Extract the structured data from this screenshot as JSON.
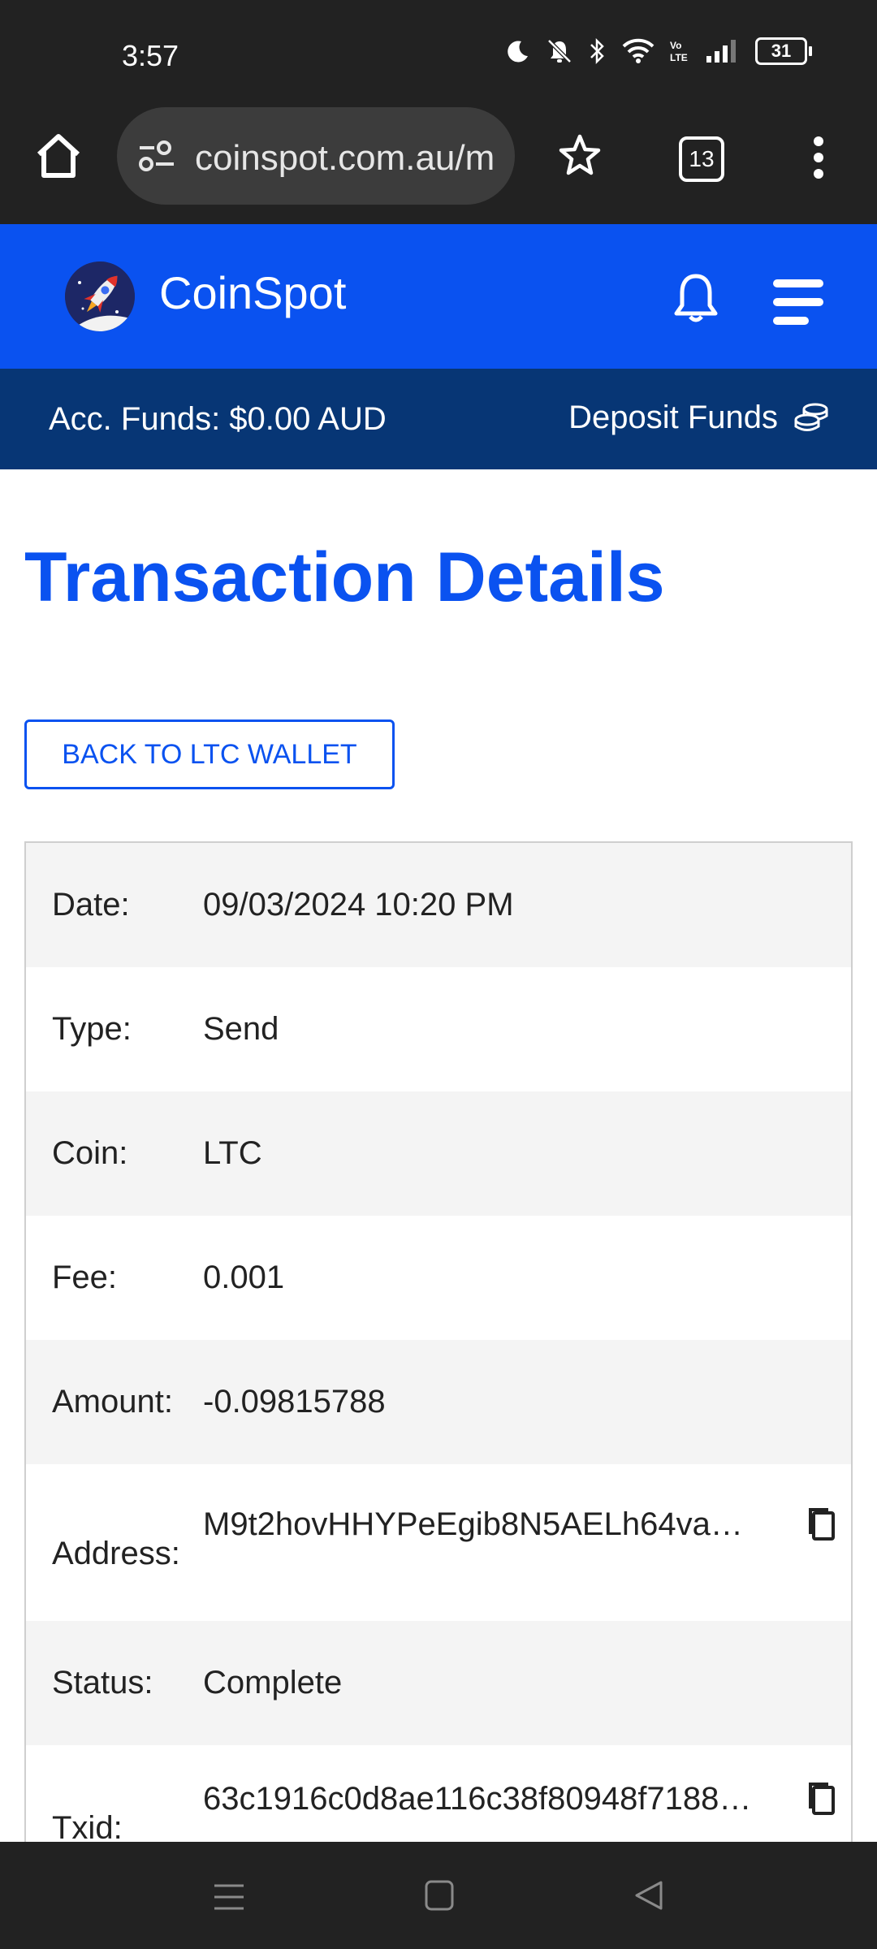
{
  "status_bar": {
    "time": "3:57",
    "battery": "31",
    "icons": [
      "moon-icon",
      "bell-off-icon",
      "bluetooth-icon",
      "wifi-icon",
      "volte-icon",
      "signal-icon",
      "battery-icon"
    ]
  },
  "browser": {
    "url": "coinspot.com.au/m",
    "tab_count": "13"
  },
  "site_header": {
    "brand": "CoinSpot"
  },
  "funds_bar": {
    "account_funds": "Acc. Funds: $0.00 AUD",
    "deposit_label": "Deposit Funds"
  },
  "page": {
    "title": "Transaction Details",
    "back_button": "BACK TO LTC WALLET"
  },
  "details": [
    {
      "label": "Date:",
      "value": "09/03/2024 10:20 PM"
    },
    {
      "label": "Type:",
      "value": "Send"
    },
    {
      "label": "Coin:",
      "value": "LTC"
    },
    {
      "label": "Fee:",
      "value": "0.001"
    },
    {
      "label": "Amount:",
      "value": "-0.09815788"
    },
    {
      "label": "Address:",
      "value": "M9t2hovHHYPeEgib8N5AELh64va8..."
    },
    {
      "label": "Status:",
      "value": "Complete"
    },
    {
      "label": "Txid:",
      "value": "63c1916c0d8ae116c38f80948f7188b..."
    }
  ],
  "colors": {
    "brand_blue": "#0a52f0",
    "funds_bar": "#073675",
    "system_bar": "#222222",
    "row_alt": "#f4f4f4"
  }
}
